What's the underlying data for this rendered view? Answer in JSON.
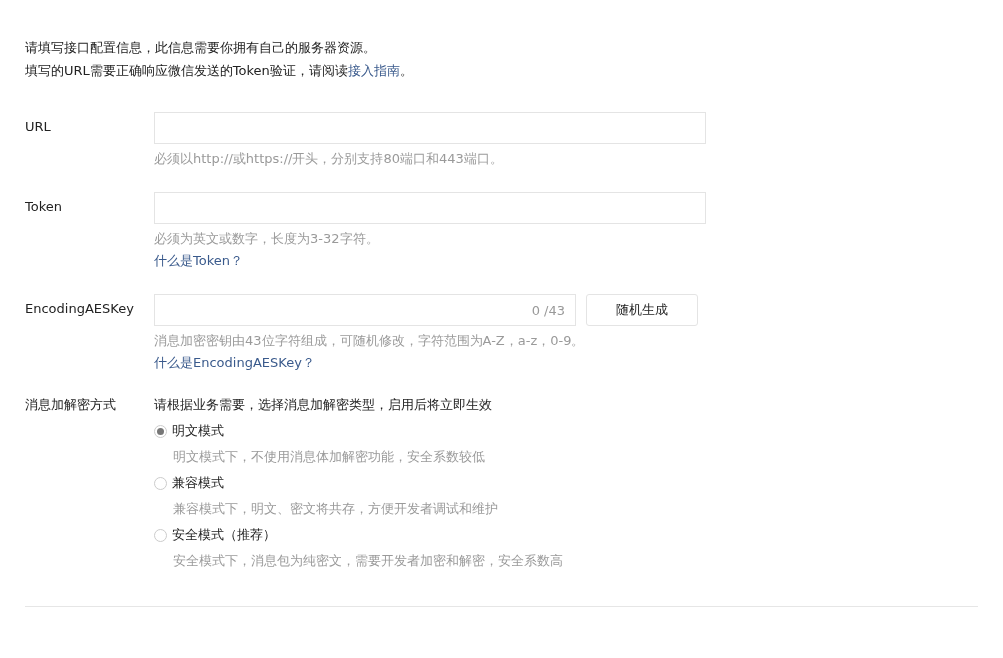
{
  "intro": {
    "line1": "请填写接口配置信息，此信息需要你拥有自己的服务器资源。",
    "line2_before": "填写的URL需要正确响应微信发送的Token验证，请阅读",
    "line2_link": "接入指南",
    "line2_after": "。"
  },
  "fields": [
    {
      "kind": "text",
      "label": "URL",
      "hint": "必须以http://或https://开头，分别支持80端口和443端口。"
    },
    {
      "kind": "text",
      "label": "Token",
      "hint": "必须为英文或数字，长度为3-32字符。",
      "help_link": "什么是Token？"
    },
    {
      "kind": "key",
      "label": "EncodingAESKey",
      "counter": "0 /43",
      "button": "随机生成",
      "hint": "消息加密密钥由43位字符组成，可随机修改，字符范围为A-Z，a-z，0-9。",
      "help_link": "什么是EncodingAESKey？"
    }
  ],
  "encryption": {
    "label": "消息加解密方式",
    "description": "请根据业务需要，选择消息加解密类型，启用后将立即生效",
    "options": [
      {
        "label": "明文模式",
        "selected": true,
        "hint": "明文模式下，不使用消息体加解密功能，安全系数较低"
      },
      {
        "label": "兼容模式",
        "selected": false,
        "hint": "兼容模式下，明文、密文将共存，方便开发者调试和维护"
      },
      {
        "label": "安全模式（推荐）",
        "selected": false,
        "hint": "安全模式下，消息包为纯密文，需要开发者加密和解密，安全系数高"
      }
    ]
  }
}
